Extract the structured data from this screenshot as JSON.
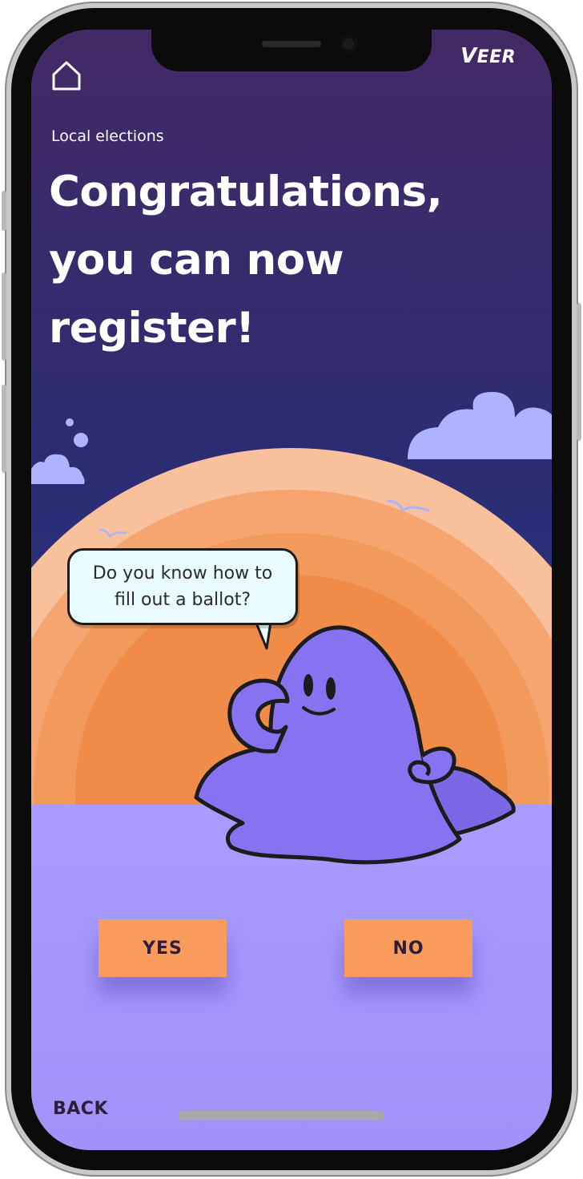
{
  "header": {
    "brand": "VEER",
    "home_icon": "home-icon"
  },
  "content": {
    "eyebrow": "Local elections",
    "headline_lines": [
      "Congratulations,",
      "you can now",
      "register!"
    ]
  },
  "illustration": {
    "speech_bubble_lines": [
      "Do you know how to",
      "fill out a ballot?"
    ],
    "character": "purple-blob-mascot"
  },
  "actions": {
    "yes_label": "YES",
    "no_label": "NO",
    "back_label": "BACK"
  },
  "colors": {
    "sky_top": "#432a66",
    "sky_bottom": "#263780",
    "sun_outer": "#f9c09c",
    "sun_inner": "#f28a45",
    "ground": "#a596fb",
    "mascot": "#8772f1",
    "cloud": "#aeb2ff",
    "button": "#f89b5d",
    "button_text": "#2d1f3a"
  }
}
